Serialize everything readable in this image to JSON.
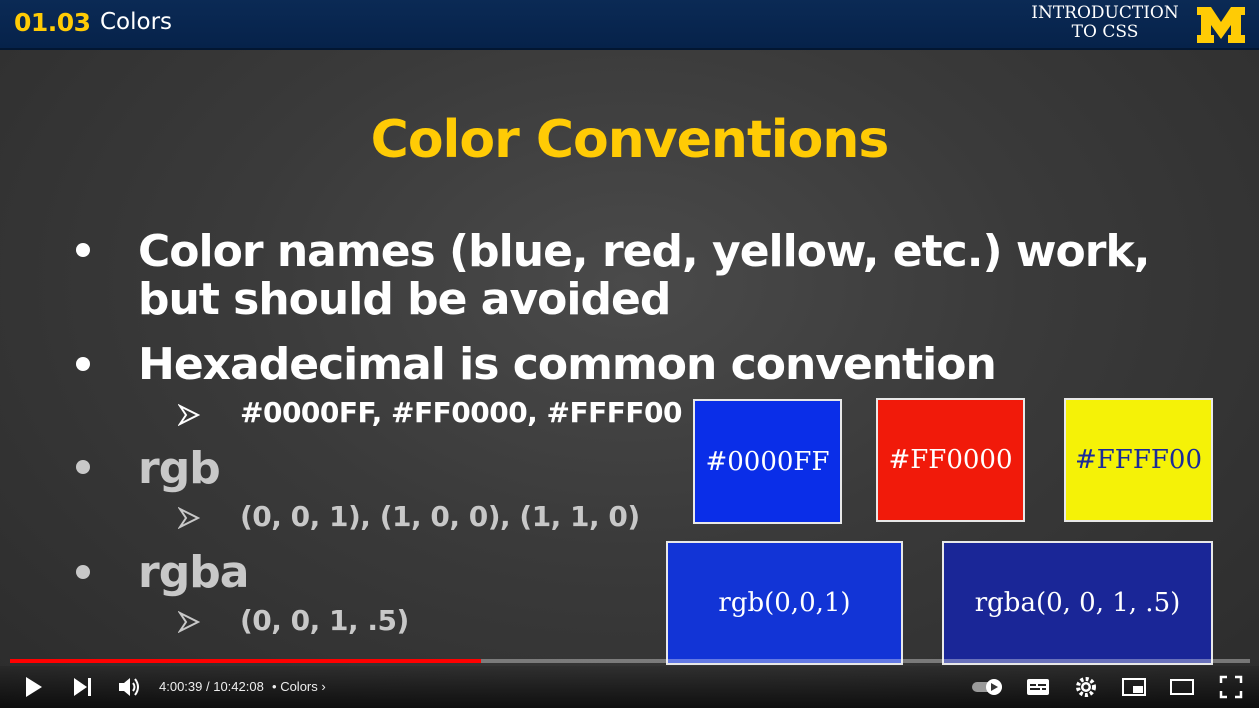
{
  "header": {
    "lesson_number": "01.03",
    "lesson_title": "Colors",
    "course_name_line1": "INTRODUCTION",
    "course_name_line2": "TO CSS",
    "logo_icon": "michigan-m-logo",
    "logo_color": "#ffcb05"
  },
  "slide": {
    "title": "Color Conventions",
    "bullets": [
      {
        "line1": "Color names (blue, red, yellow, etc.) work,",
        "line2": "but should be avoided"
      },
      {
        "line1": "Hexadecimal is common convention",
        "sub": "#0000FF, #FF0000, #FFFF00"
      },
      {
        "line1": "rgb",
        "sub": "(0, 0, 1), (1, 0, 0), (1, 1, 0)"
      },
      {
        "line1": "rgba",
        "sub": "(0, 0, 1, .5)"
      }
    ],
    "swatches": [
      {
        "label": "#0000FF",
        "bg": "#0a2ee8",
        "fg": "#ffffff"
      },
      {
        "label": "#FF0000",
        "bg": "#f11a0a",
        "fg": "#ffffff"
      },
      {
        "label": "#FFFF00",
        "bg": "#f5f207",
        "fg": "#1a2a9a"
      },
      {
        "label": "rgb(0,0,1)",
        "bg": "#1234d6",
        "fg": "#ffffff"
      },
      {
        "label": "rgba(0, 0, 1, .5)",
        "bg": "#1a2697",
        "fg": "#ffffff"
      }
    ],
    "accent_color": "#ffcb05"
  },
  "player": {
    "current_time": "4:00:39",
    "separator": " / ",
    "duration": "10:42:08",
    "chapter_bullet": "•",
    "chapter": "Colors",
    "progress": 0.38,
    "progress_color": "#ff0000",
    "icons": [
      "play-icon",
      "next-icon",
      "volume-icon",
      "autoplay-toggle-icon",
      "subtitles-icon",
      "settings-icon",
      "miniplayer-icon",
      "theater-mode-icon",
      "fullscreen-icon"
    ]
  }
}
